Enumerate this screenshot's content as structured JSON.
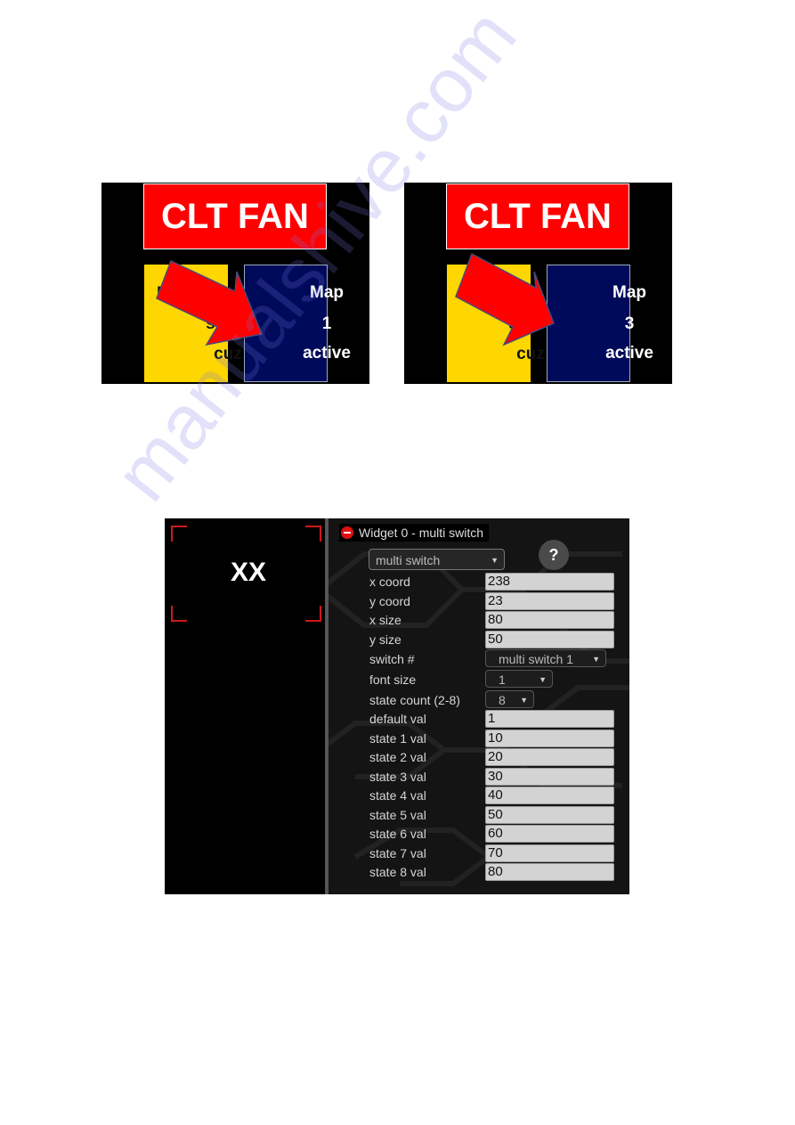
{
  "screens": [
    {
      "banner": "CLT FAN",
      "left_box": [
        "F",
        "seato",
        "cuz"
      ],
      "right_box": [
        "Map",
        "1",
        "active"
      ]
    },
    {
      "banner": "CLT FAN",
      "left_box": [
        "",
        "seato",
        "cuz"
      ],
      "right_box": [
        "Map",
        "3",
        "active"
      ]
    }
  ],
  "colors": {
    "banner_red": "#ff0000",
    "yellow_box": "#ffd700",
    "navy_box": "#000a5a",
    "arrow_red": "#ff0000"
  },
  "editor": {
    "preview_text": "XX",
    "header": "Widget 0 - multi switch",
    "type_select": "multi switch",
    "help": "?",
    "fields": [
      {
        "label": "x coord",
        "value": "238",
        "kind": "input"
      },
      {
        "label": "y coord",
        "value": "23",
        "kind": "input"
      },
      {
        "label": "x size",
        "value": "80",
        "kind": "input"
      },
      {
        "label": "y size",
        "value": "50",
        "kind": "input"
      },
      {
        "label": "switch #",
        "value": "multi switch 1",
        "kind": "select"
      },
      {
        "label": "font size",
        "value": "1",
        "kind": "select"
      },
      {
        "label": "state count (2-8)",
        "value": "8",
        "kind": "select"
      },
      {
        "label": "default val",
        "value": "1",
        "kind": "input"
      },
      {
        "label": "state 1 val",
        "value": "10",
        "kind": "input"
      },
      {
        "label": "state 2 val",
        "value": "20",
        "kind": "input"
      },
      {
        "label": "state 3 val",
        "value": "30",
        "kind": "input"
      },
      {
        "label": "state 4 val",
        "value": "40",
        "kind": "input"
      },
      {
        "label": "state 5 val",
        "value": "50",
        "kind": "input"
      },
      {
        "label": "state 6 val",
        "value": "60",
        "kind": "input"
      },
      {
        "label": "state 7 val",
        "value": "70",
        "kind": "input"
      },
      {
        "label": "state 8 val",
        "value": "80",
        "kind": "input"
      }
    ]
  },
  "watermark": "manualshive.com"
}
